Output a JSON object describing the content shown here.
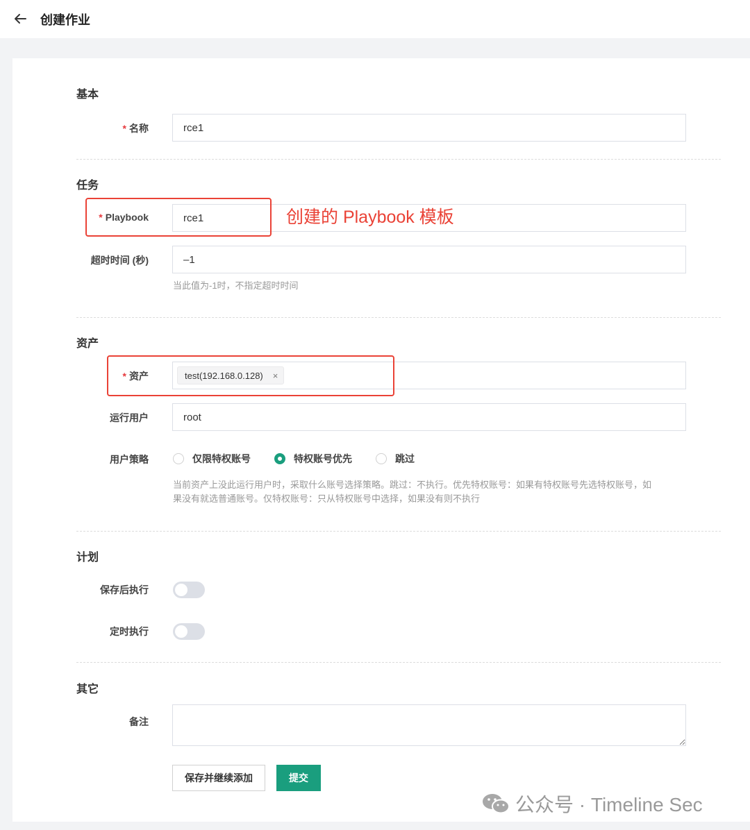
{
  "header": {
    "title": "创建作业"
  },
  "sections": {
    "basic": "基本",
    "task": "任务",
    "assets": "资产",
    "plan": "计划",
    "other": "其它"
  },
  "fields": {
    "name": {
      "label": "名称",
      "value": "rce1"
    },
    "playbook": {
      "label": "Playbook",
      "value": "rce1"
    },
    "timeout": {
      "label": "超时时间 (秒)",
      "value": "–1",
      "help": "当此值为-1时，不指定超时时间"
    },
    "assets": {
      "label": "资产",
      "tags": [
        "test(192.168.0.128)"
      ],
      "tag_close": "×"
    },
    "runas": {
      "label": "运行用户",
      "value": "root"
    },
    "policy": {
      "label": "用户策略",
      "options": [
        "仅限特权账号",
        "特权账号优先",
        "跳过"
      ],
      "selected": "特权账号优先",
      "help_line1": "当前资产上没此运行用户时，采取什么账号选择策略。跳过：不执行。优先特权账号：如果有特权账号先选特权账号，如",
      "help_line2": "果没有就选普通账号。仅特权账号：只从特权账号中选择，如果没有则不执行"
    },
    "run_after_save": {
      "label": "保存后执行",
      "enabled": false
    },
    "scheduled": {
      "label": "定时执行",
      "enabled": false
    },
    "comment": {
      "label": "备注",
      "value": ""
    }
  },
  "buttons": {
    "save_continue": "保存并继续添加",
    "submit": "提交"
  },
  "annotation": {
    "text": "创建的 Playbook 模板"
  },
  "watermark": {
    "text": "公众号 · Timeline Sec"
  },
  "colors": {
    "primary": "#1a9e7e",
    "required": "#e6393d",
    "highlight": "#ea4236"
  }
}
